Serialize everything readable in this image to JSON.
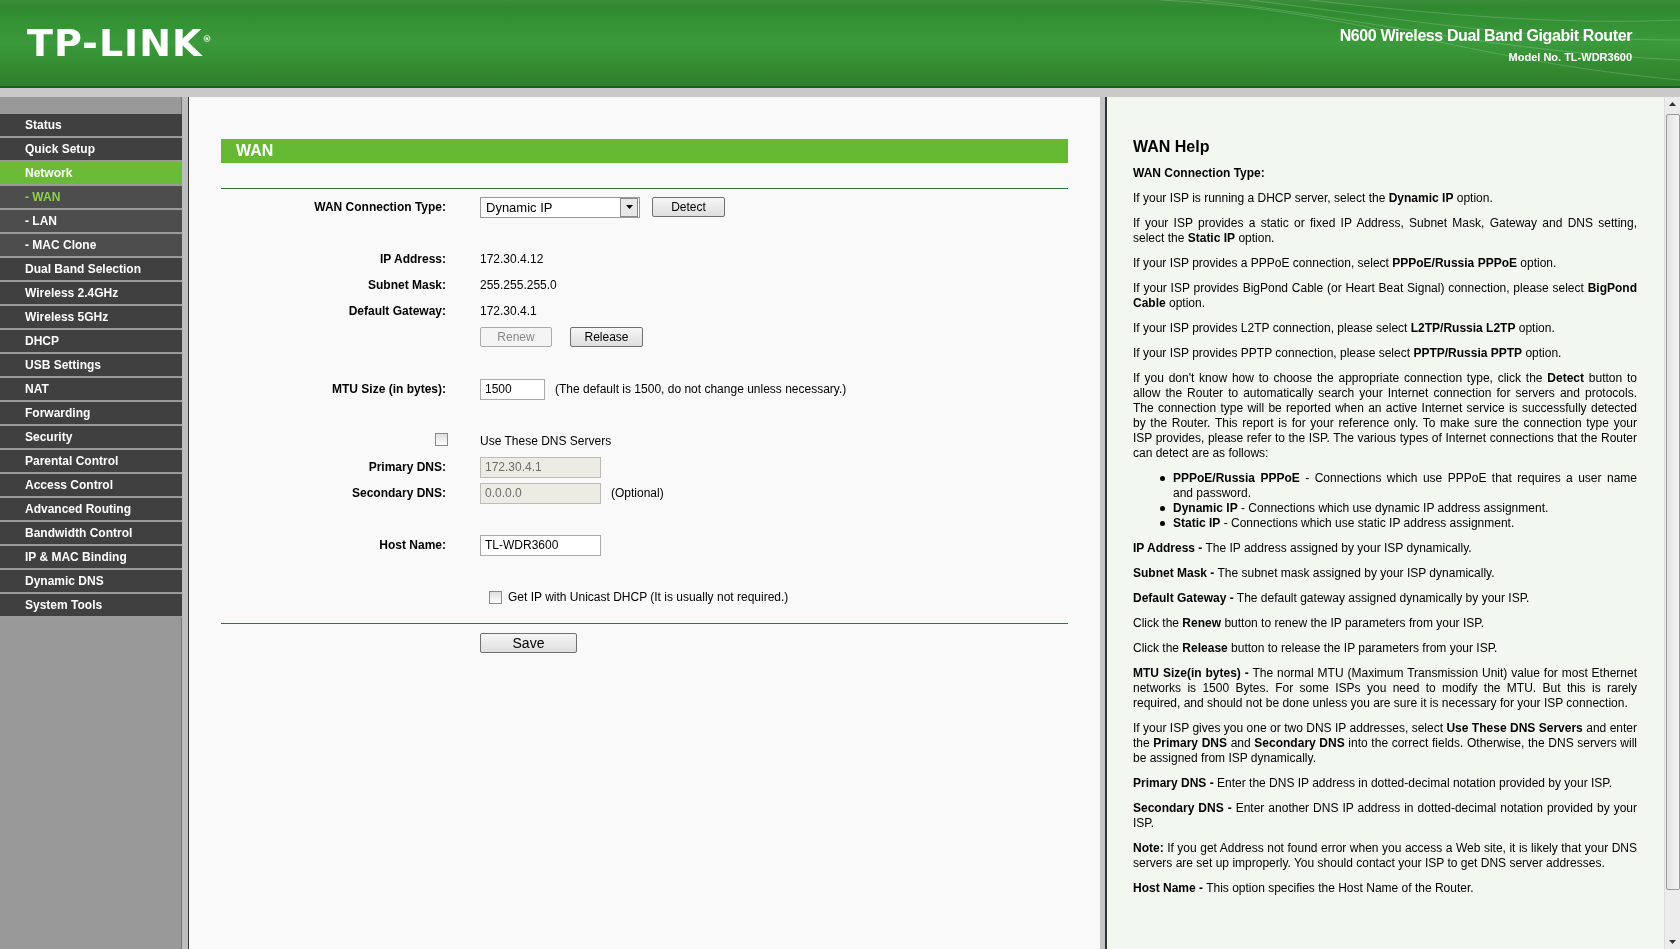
{
  "header": {
    "logo": "TP-LINK$^{®}$",
    "product": "N600 Wireless Dual Band Gigabit Router",
    "model": "Model No. TL-WDR3600"
  },
  "sidebar": {
    "items": [
      {
        "label": "Status",
        "kind": "main",
        "selected": false
      },
      {
        "label": "Quick Setup",
        "kind": "main",
        "selected": false
      },
      {
        "label": "Network",
        "kind": "main",
        "selected": true
      },
      {
        "label": "- WAN",
        "kind": "sub",
        "selected": true
      },
      {
        "label": "- LAN",
        "kind": "sub",
        "selected": false
      },
      {
        "label": "- MAC Clone",
        "kind": "sub",
        "selected": false
      },
      {
        "label": "Dual Band Selection",
        "kind": "main",
        "selected": false
      },
      {
        "label": "Wireless 2.4GHz",
        "kind": "main",
        "selected": false
      },
      {
        "label": "Wireless 5GHz",
        "kind": "main",
        "selected": false
      },
      {
        "label": "DHCP",
        "kind": "main",
        "selected": false
      },
      {
        "label": "USB Settings",
        "kind": "main",
        "selected": false
      },
      {
        "label": "NAT",
        "kind": "main",
        "selected": false
      },
      {
        "label": "Forwarding",
        "kind": "main",
        "selected": false
      },
      {
        "label": "Security",
        "kind": "main",
        "selected": false
      },
      {
        "label": "Parental Control",
        "kind": "main",
        "selected": false
      },
      {
        "label": "Access Control",
        "kind": "main",
        "selected": false
      },
      {
        "label": "Advanced Routing",
        "kind": "main",
        "selected": false
      },
      {
        "label": "Bandwidth Control",
        "kind": "main",
        "selected": false
      },
      {
        "label": "IP & MAC Binding",
        "kind": "main",
        "selected": false
      },
      {
        "label": "Dynamic DNS",
        "kind": "main",
        "selected": false
      },
      {
        "label": "System Tools",
        "kind": "main",
        "selected": false
      }
    ]
  },
  "form": {
    "title": "WAN",
    "connection_type": {
      "label": "WAN Connection Type:",
      "value": "Dynamic IP",
      "button": "Detect"
    },
    "info": [
      {
        "label": "IP Address:",
        "value": "172.30.4.12"
      },
      {
        "label": "Subnet Mask:",
        "value": "255.255.255.0"
      },
      {
        "label": "Default Gateway:",
        "value": "172.30.4.1"
      }
    ],
    "renew_button": {
      "label": "Renew",
      "disabled": true
    },
    "release_button": {
      "label": "Release",
      "disabled": false
    },
    "mtu": {
      "label": "MTU Size (in bytes):",
      "value": "1500",
      "note": "(The default is 1500, do not change unless necessary.)"
    },
    "dns_checkbox": {
      "label": "Use These DNS Servers",
      "checked": false
    },
    "primary_dns": {
      "label": "Primary DNS:",
      "value": "172.30.4.1",
      "disabled": true
    },
    "secondary_dns": {
      "label": "Secondary DNS:",
      "value": "0.0.0.0",
      "disabled": true,
      "note": "(Optional)"
    },
    "host_name": {
      "label": "Host Name:",
      "value": "TL-WDR3600"
    },
    "unicast_checkbox": {
      "label": "Get IP with Unicast DHCP (It is usually not required.)",
      "checked": false
    },
    "save_button": "Save"
  },
  "help": {
    "title": "WAN Help",
    "blocks": [
      {
        "kind": "heading",
        "text": "WAN Connection Type:"
      },
      {
        "kind": "para",
        "text": "If your ISP is running a DHCP server, select the **Dynamic IP** option."
      },
      {
        "kind": "para",
        "text": "If your ISP provides a static or fixed IP Address, Subnet Mask, Gateway and DNS setting, select the **Static IP** option."
      },
      {
        "kind": "para",
        "text": "If your ISP provides a PPPoE connection, select **PPPoE/Russia PPPoE** option."
      },
      {
        "kind": "para",
        "text": "If your ISP provides BigPond Cable (or Heart Beat Signal) connection, please select **BigPond Cable** option."
      },
      {
        "kind": "para",
        "text": "If your ISP provides L2TP connection, please select **L2TP/Russia L2TP** option."
      },
      {
        "kind": "para",
        "text": "If your ISP provides PPTP connection, please select **PPTP/Russia PPTP** option."
      },
      {
        "kind": "para",
        "text": "If you don't know how to choose the appropriate connection type, click the **Detect** button to allow the Router to automatically search your Internet connection for servers and protocols. The connection type will be reported when an active Internet service is successfully detected by the Router. This report is for your reference only. To make sure the connection type your ISP provides, please refer to the ISP. The various types of Internet connections that the Router can detect are as follows:"
      },
      {
        "kind": "list",
        "items": [
          "**PPPoE/Russia PPPoE** - Connections which use PPPoE that requires a user name and password.",
          "**Dynamic IP** - Connections which use dynamic IP address assignment.",
          "**Static IP** - Connections which use static IP address assignment."
        ]
      },
      {
        "kind": "para",
        "text": "**IP Address -** The IP address assigned by your ISP dynamically."
      },
      {
        "kind": "para",
        "text": "**Subnet Mask -** The subnet mask assigned by your ISP dynamically."
      },
      {
        "kind": "para",
        "text": "**Default Gateway -** The default gateway assigned dynamically by your ISP."
      },
      {
        "kind": "para",
        "text": "Click the **Renew** button to renew the IP parameters from your ISP."
      },
      {
        "kind": "para",
        "text": "Click the **Release** button to release the IP parameters from your ISP."
      },
      {
        "kind": "para",
        "text": "**MTU Size(in bytes) -** The normal MTU (Maximum Transmission Unit) value for most Ethernet networks is 1500 Bytes. For some ISPs you need to modify the MTU. But this is rarely required, and should not be done unless you are sure it is necessary for your ISP connection."
      },
      {
        "kind": "para",
        "text": "If your ISP gives you one or two DNS IP addresses, select **Use These DNS Servers** and enter the **Primary DNS** and **Secondary DNS** into the correct fields. Otherwise, the DNS servers will be assigned from ISP dynamically."
      },
      {
        "kind": "para",
        "text": "**Primary DNS -** Enter the DNS IP address in dotted-decimal notation provided by your ISP."
      },
      {
        "kind": "para",
        "text": "**Secondary DNS -** Enter another DNS IP address in dotted-decimal notation provided by your ISP."
      },
      {
        "kind": "para",
        "text": "**Note:** If you get Address not found error when you access a Web site, it is likely that your DNS servers are set up improperly. You should contact your ISP to get DNS server addresses."
      },
      {
        "kind": "para",
        "text": "**Host Name -** This option specifies the Host Name of the Router."
      }
    ]
  }
}
